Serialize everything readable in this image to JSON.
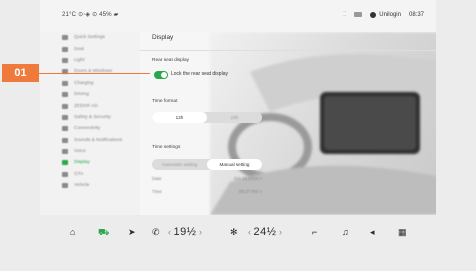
{
  "status": {
    "left_text": "21°C ⊙⋅◈  ⊙ 45%  ▰",
    "user_name": "Unilogin",
    "time": "08:37"
  },
  "sidebar": {
    "items": [
      {
        "label": "Quick Settings",
        "active": false
      },
      {
        "label": "Seat",
        "active": false
      },
      {
        "label": "Light",
        "active": false
      },
      {
        "label": "Doors & Windows",
        "active": false
      },
      {
        "label": "Charging",
        "active": false
      },
      {
        "label": "Driving",
        "active": false
      },
      {
        "label": "ZEEKR AD",
        "active": false
      },
      {
        "label": "Safety & Security",
        "active": false
      },
      {
        "label": "Connectivity",
        "active": false
      },
      {
        "label": "Sounds & Notifications",
        "active": false
      },
      {
        "label": "Voice",
        "active": false
      },
      {
        "label": "Display",
        "active": true
      },
      {
        "label": "OTA",
        "active": false
      },
      {
        "label": "Vehicle",
        "active": false
      }
    ]
  },
  "main": {
    "title": "Display",
    "rear_seat": {
      "section_label": "Rear seat display",
      "toggle_label": "Lock the rear seat display",
      "on": true
    },
    "time_format": {
      "section_label": "Time format",
      "options": [
        "12h",
        "24h"
      ],
      "selected": "12h"
    },
    "time_settings": {
      "section_label": "Time settings",
      "options": [
        "Automatic setting",
        "Manual setting"
      ],
      "selected": "Manual setting",
      "date_label": "Date",
      "date_value": "Oct 16,2023 >",
      "time_label": "Time",
      "time_value": "08:37 PM >"
    }
  },
  "dock": {
    "left_temp": "19½",
    "right_temp": "24½",
    "chevron_left": "‹",
    "chevron_right": "›"
  },
  "callout": {
    "label": "01",
    "color": "#f07a3b"
  },
  "colors": {
    "accent": "#27a84a",
    "background": "#ececec"
  }
}
